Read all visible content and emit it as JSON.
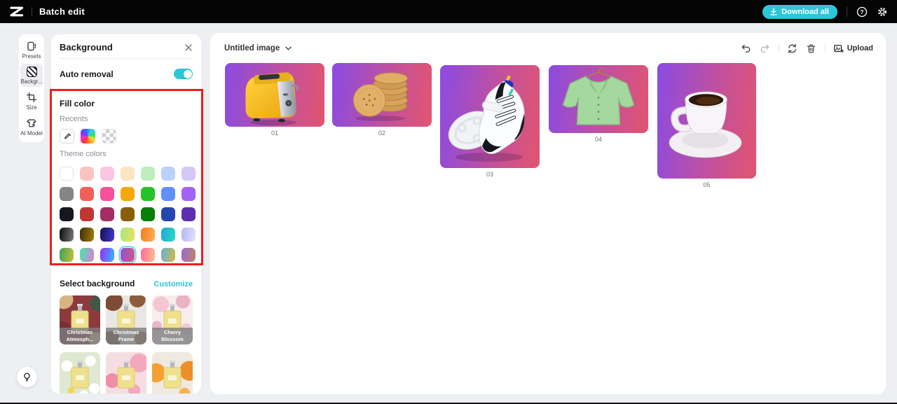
{
  "topbar": {
    "app_title": "Batch edit",
    "download_label": "Download all",
    "icons": [
      "download-icon",
      "help-icon",
      "settings-icon"
    ]
  },
  "sidebar": {
    "items": [
      {
        "label": "Presets",
        "icon": "presets-icon",
        "active": false
      },
      {
        "label": "Backgr...",
        "icon": "background-icon",
        "active": true
      },
      {
        "label": "Size",
        "icon": "size-icon",
        "active": false
      },
      {
        "label": "AI Model",
        "icon": "ai-model-icon",
        "active": false
      }
    ]
  },
  "panel": {
    "title": "Background",
    "close_icon": "close-icon",
    "auto_removal": {
      "label": "Auto removal",
      "enabled": true
    },
    "fill_color": {
      "title": "Fill color",
      "recents_label": "Recents",
      "recent_swatches": [
        "eyedropper",
        "rainbow-gradient",
        "transparent-checkerboard"
      ],
      "theme_label": "Theme colors",
      "selected_swatch": {
        "row": 5,
        "col": 4
      },
      "theme_rows": [
        [
          {
            "c": "#ffffff",
            "border": true
          },
          {
            "c": "#fbc4c0"
          },
          {
            "c": "#fac6e0"
          },
          {
            "c": "#fae6c0"
          },
          {
            "c": "#c0edbd"
          },
          {
            "c": "#b9d2fa"
          },
          {
            "c": "#d4c8f6"
          }
        ],
        [
          {
            "c": "#858588"
          },
          {
            "c": "#f15f58"
          },
          {
            "c": "#f8509a"
          },
          {
            "c": "#f6a70a"
          },
          {
            "c": "#27c226"
          },
          {
            "c": "#6091f8"
          },
          {
            "c": "#a163f5"
          }
        ],
        [
          {
            "c": "#15161e"
          },
          {
            "c": "#c03732"
          },
          {
            "c": "#a42e64"
          },
          {
            "c": "#8a5f09"
          },
          {
            "c": "#077d0a"
          },
          {
            "c": "#2446ae"
          },
          {
            "c": "#5c2fb0"
          }
        ],
        [
          {
            "g": [
              "#0d0d0f",
              "#7a7a7e"
            ]
          },
          {
            "g": [
              "#3c2d04",
              "#a87c10"
            ]
          },
          {
            "g": [
              "#16114e",
              "#4338d4"
            ]
          },
          {
            "g": [
              "#a4e87c",
              "#eede5e"
            ]
          },
          {
            "g": [
              "#f47a20",
              "#fcb050"
            ]
          },
          {
            "g": [
              "#22a8dc",
              "#2cd8c0"
            ]
          },
          {
            "g": [
              "#b2b4f8",
              "#e6e2fc"
            ]
          }
        ],
        [
          {
            "g": [
              "#3ba05e",
              "#c8c336"
            ]
          },
          {
            "g": [
              "#4ae5ae",
              "#d781d8"
            ]
          },
          {
            "g": [
              "#9a2df7",
              "#33b5ff"
            ]
          },
          {
            "g": [
              "#8f52d8",
              "#cf5b80"
            ],
            "selected": true
          },
          {
            "g": [
              "#ff6b9d",
              "#ffbf8a"
            ]
          },
          {
            "g": [
              "#6aaede",
              "#c9c13e"
            ]
          },
          {
            "g": [
              "#9a69d6",
              "#bd8760"
            ]
          }
        ]
      ]
    },
    "select_background": {
      "title": "Select background",
      "customize_label": "Customize",
      "presets": [
        {
          "label": "Christmas Atmosph...",
          "image": "christmas-atmosphere"
        },
        {
          "label": "Christmas Frame",
          "image": "christmas-frame"
        },
        {
          "label": "Cherry Blossom",
          "image": "cherry-blossom"
        },
        {
          "label": "",
          "image": "daisy"
        },
        {
          "label": "",
          "image": "pink-flowers"
        },
        {
          "label": "",
          "image": "orange-flowers"
        }
      ]
    }
  },
  "canvas": {
    "doc_title": "Untitled image",
    "toolbar_icons": [
      "undo-icon",
      "redo-icon",
      "reset-icon",
      "trash-icon"
    ],
    "upload_label": "Upload",
    "card_gradient": [
      "#8a4be2",
      "#c1509f",
      "#e2556f"
    ],
    "images": [
      {
        "label": "01",
        "item": "toaster"
      },
      {
        "label": "02",
        "item": "cookies"
      },
      {
        "label": "03",
        "item": "sneakers"
      },
      {
        "label": "04",
        "item": "shirt"
      },
      {
        "label": "05",
        "item": "coffee-cup"
      }
    ]
  },
  "assistant": {
    "icon": "lightbulb-icon"
  },
  "colors": {
    "accent_cyan": "#2cc7d7",
    "highlight_red": "#f01c1c",
    "topbar_black": "#050506"
  }
}
